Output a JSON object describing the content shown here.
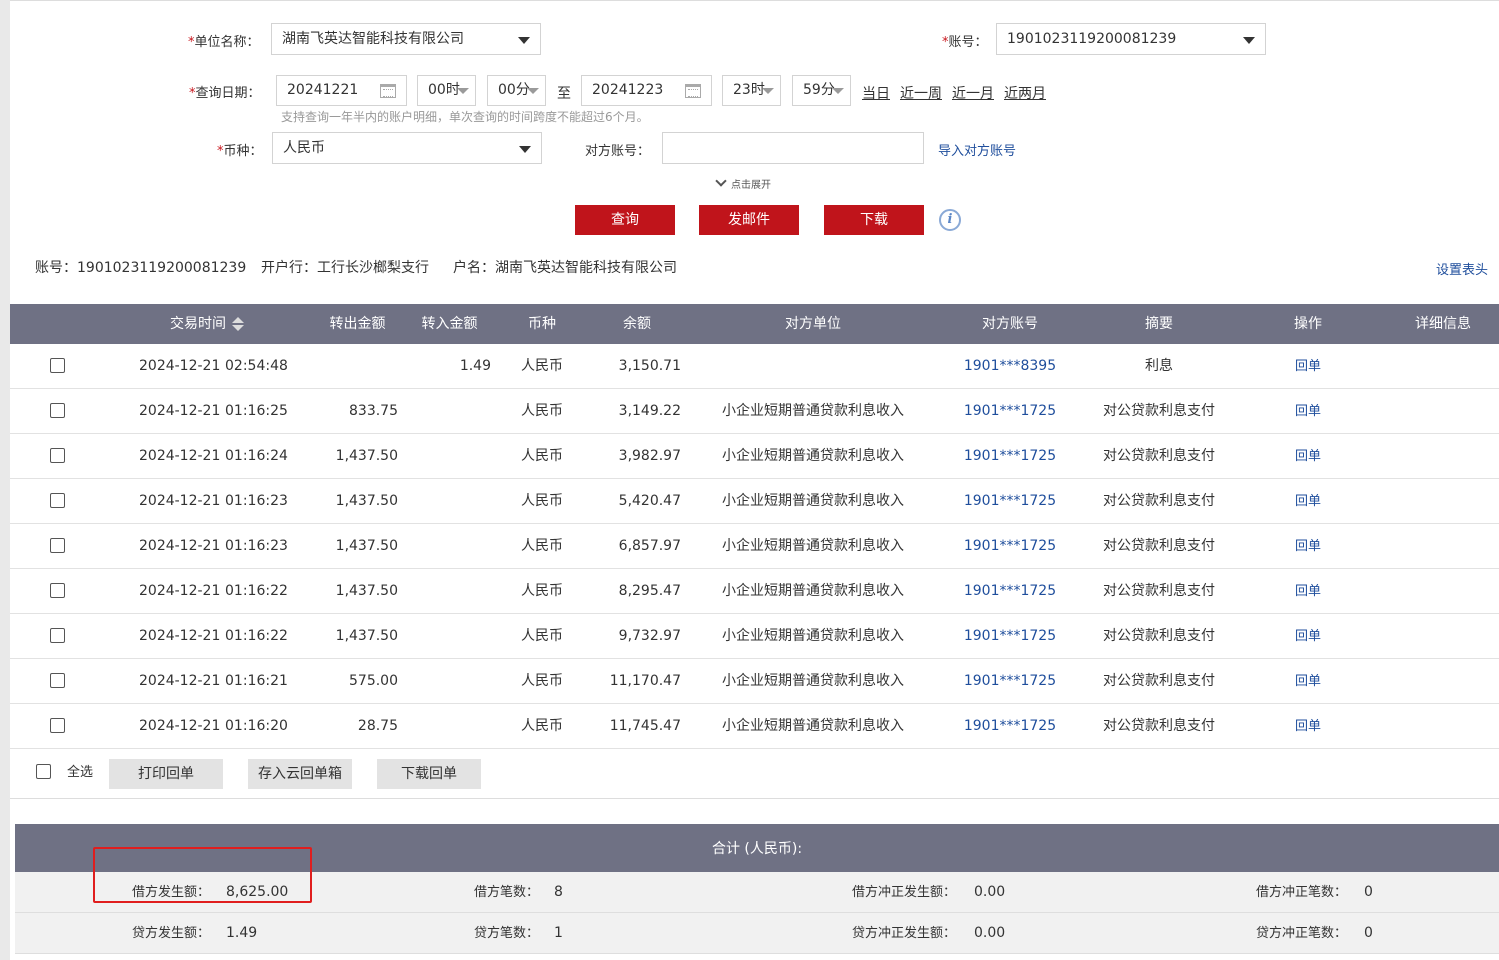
{
  "form": {
    "unit_label": "单位名称：",
    "unit_value": "湖南飞英达智能科技有限公司",
    "account_label": "账号：",
    "account_value": "1901023119200081239",
    "date_label": "查询日期：",
    "start_date": "20241221",
    "start_hour": "00时",
    "start_min": "00分",
    "to_label": "至",
    "end_date": "20241223",
    "end_hour": "23时",
    "end_min": "59分",
    "quick_today": "当日",
    "quick_week": "近一周",
    "quick_month": "近一月",
    "quick_two_months": "近两月",
    "hint": "支持查询一年半内的账户明细，单次查询的时间跨度不能超过6个月。",
    "currency_label": "币种：",
    "currency_value": "人民币",
    "counterpart_label": "对方账号：",
    "counterpart_value": "",
    "import_counterpart": "导入对方账号",
    "expand_label": "点击展开",
    "required_mark": "*"
  },
  "actions": {
    "query": "查询",
    "email": "发邮件",
    "download": "下载",
    "info_icon": "i"
  },
  "account_info": {
    "account": "账号：1901023119200081239",
    "bank": "开户行：工行长沙榔梨支行",
    "name": "户名：湖南飞英达智能科技有限公司",
    "set_header": "设置表头"
  },
  "table": {
    "headers": {
      "time": "交易时间",
      "out_amount": "转出金额",
      "in_amount": "转入金额",
      "currency": "币种",
      "balance": "余额",
      "counter_unit": "对方单位",
      "counter_account": "对方账号",
      "summary": "摘要",
      "operation": "操作",
      "details": "详细信息"
    },
    "rows": [
      {
        "date": "2024-12-21",
        "time": "02:54:48",
        "out": "",
        "in": "1.49",
        "currency": "人民币",
        "balance": "3,150.71",
        "unit": "",
        "account": "1901***8395",
        "summary": "利息",
        "op": "回单"
      },
      {
        "date": "2024-12-21",
        "time": "01:16:25",
        "out": "833.75",
        "in": "",
        "currency": "人民币",
        "balance": "3,149.22",
        "unit": "小企业短期普通贷款利息收入",
        "account": "1901***1725",
        "summary": "对公贷款利息支付",
        "op": "回单"
      },
      {
        "date": "2024-12-21",
        "time": "01:16:24",
        "out": "1,437.50",
        "in": "",
        "currency": "人民币",
        "balance": "3,982.97",
        "unit": "小企业短期普通贷款利息收入",
        "account": "1901***1725",
        "summary": "对公贷款利息支付",
        "op": "回单"
      },
      {
        "date": "2024-12-21",
        "time": "01:16:23",
        "out": "1,437.50",
        "in": "",
        "currency": "人民币",
        "balance": "5,420.47",
        "unit": "小企业短期普通贷款利息收入",
        "account": "1901***1725",
        "summary": "对公贷款利息支付",
        "op": "回单"
      },
      {
        "date": "2024-12-21",
        "time": "01:16:23",
        "out": "1,437.50",
        "in": "",
        "currency": "人民币",
        "balance": "6,857.97",
        "unit": "小企业短期普通贷款利息收入",
        "account": "1901***1725",
        "summary": "对公贷款利息支付",
        "op": "回单"
      },
      {
        "date": "2024-12-21",
        "time": "01:16:22",
        "out": "1,437.50",
        "in": "",
        "currency": "人民币",
        "balance": "8,295.47",
        "unit": "小企业短期普通贷款利息收入",
        "account": "1901***1725",
        "summary": "对公贷款利息支付",
        "op": "回单"
      },
      {
        "date": "2024-12-21",
        "time": "01:16:22",
        "out": "1,437.50",
        "in": "",
        "currency": "人民币",
        "balance": "9,732.97",
        "unit": "小企业短期普通贷款利息收入",
        "account": "1901***1725",
        "summary": "对公贷款利息支付",
        "op": "回单"
      },
      {
        "date": "2024-12-21",
        "time": "01:16:21",
        "out": "575.00",
        "in": "",
        "currency": "人民币",
        "balance": "11,170.47",
        "unit": "小企业短期普通贷款利息收入",
        "account": "1901***1725",
        "summary": "对公贷款利息支付",
        "op": "回单"
      },
      {
        "date": "2024-12-21",
        "time": "01:16:20",
        "out": "28.75",
        "in": "",
        "currency": "人民币",
        "balance": "11,745.47",
        "unit": "小企业短期普通贷款利息收入",
        "account": "1901***1725",
        "summary": "对公贷款利息支付",
        "op": "回单"
      }
    ]
  },
  "footer": {
    "select_all": "全选",
    "print_receipt": "打印回单",
    "save_cloud": "存入云回单箱",
    "download_receipt": "下载回单"
  },
  "summary": {
    "title": "合计 (人民币):",
    "debit_amount_label": "借方发生额：",
    "debit_amount": "8,625.00",
    "debit_count_label": "借方笔数：",
    "debit_count": "8",
    "debit_correction_amount_label": "借方冲正发生额：",
    "debit_correction_amount": "0.00",
    "debit_correction_count_label": "借方冲正笔数：",
    "debit_correction_count": "0",
    "credit_amount_label": "贷方发生额：",
    "credit_amount": "1.49",
    "credit_count_label": "贷方笔数：",
    "credit_count": "1",
    "credit_correction_amount_label": "贷方冲正发生额：",
    "credit_correction_amount": "0.00",
    "credit_correction_count_label": "贷方冲正笔数：",
    "credit_correction_count": "0"
  },
  "colors": {
    "primary_red": "#c0141b",
    "header_gray": "#6f7184",
    "link_blue": "#1f4e9c",
    "highlight_red": "#e01e1e"
  }
}
